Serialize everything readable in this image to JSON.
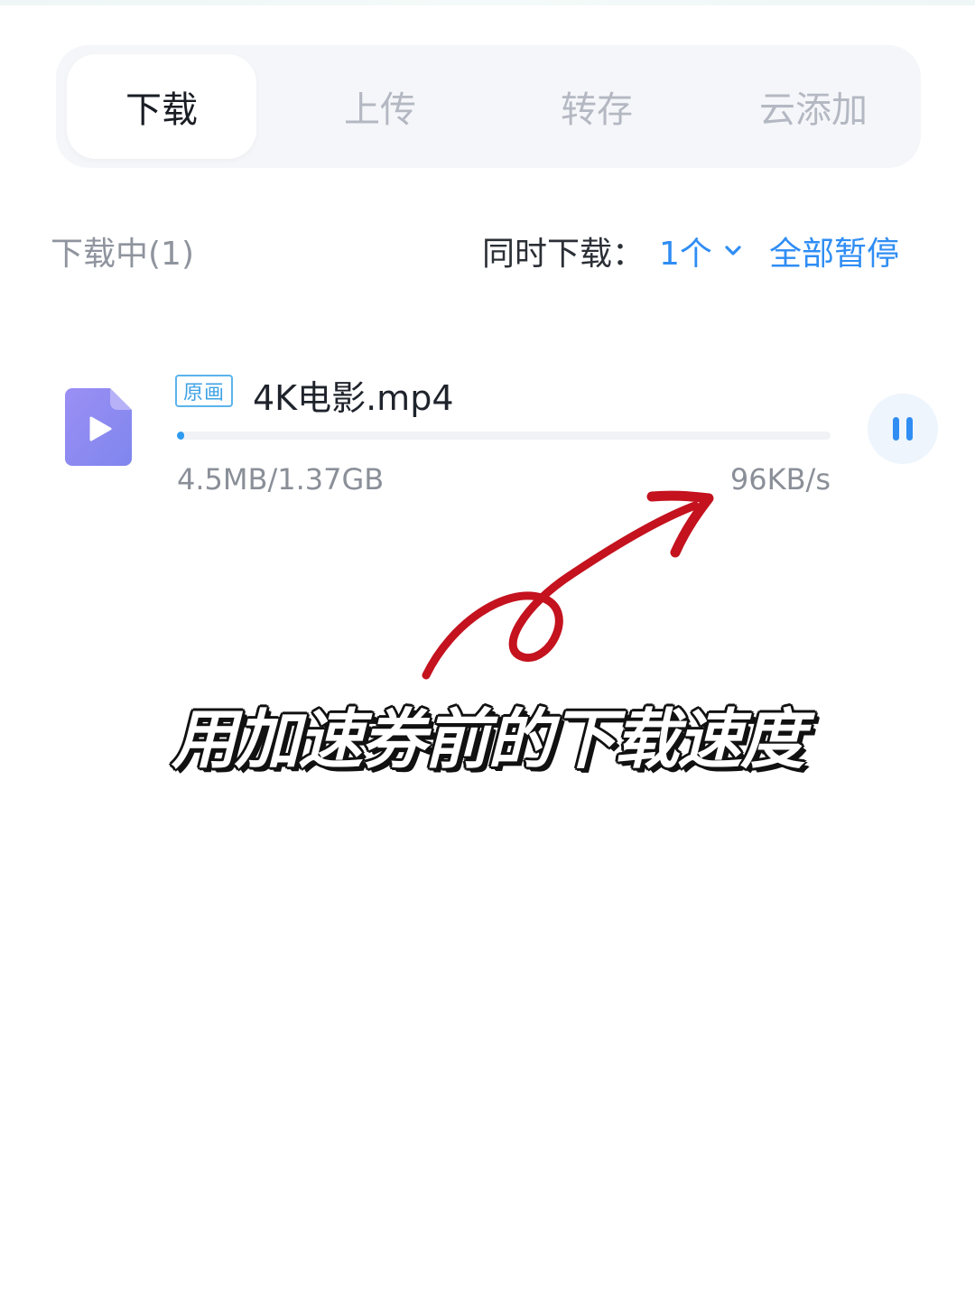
{
  "tabs": [
    {
      "label": "下载",
      "active": true
    },
    {
      "label": "上传",
      "active": false
    },
    {
      "label": "转存",
      "active": false
    },
    {
      "label": "云添加",
      "active": false
    }
  ],
  "section": {
    "title": "下载中(1)",
    "concurrent_label": "同时下载：",
    "concurrent_value": "1个",
    "pause_all": "全部暂停"
  },
  "task": {
    "badge": "原画",
    "name": "4K电影.mp4",
    "size": "4.5MB/1.37GB",
    "speed": "96KB/s",
    "progress_fraction": 0.0032,
    "icon": "video-file-icon"
  },
  "annotation": "用加速券前的下载速度",
  "colors": {
    "accent": "#2f8df4",
    "file_icon": "#8b86f0",
    "arrow": "#c4121e"
  }
}
